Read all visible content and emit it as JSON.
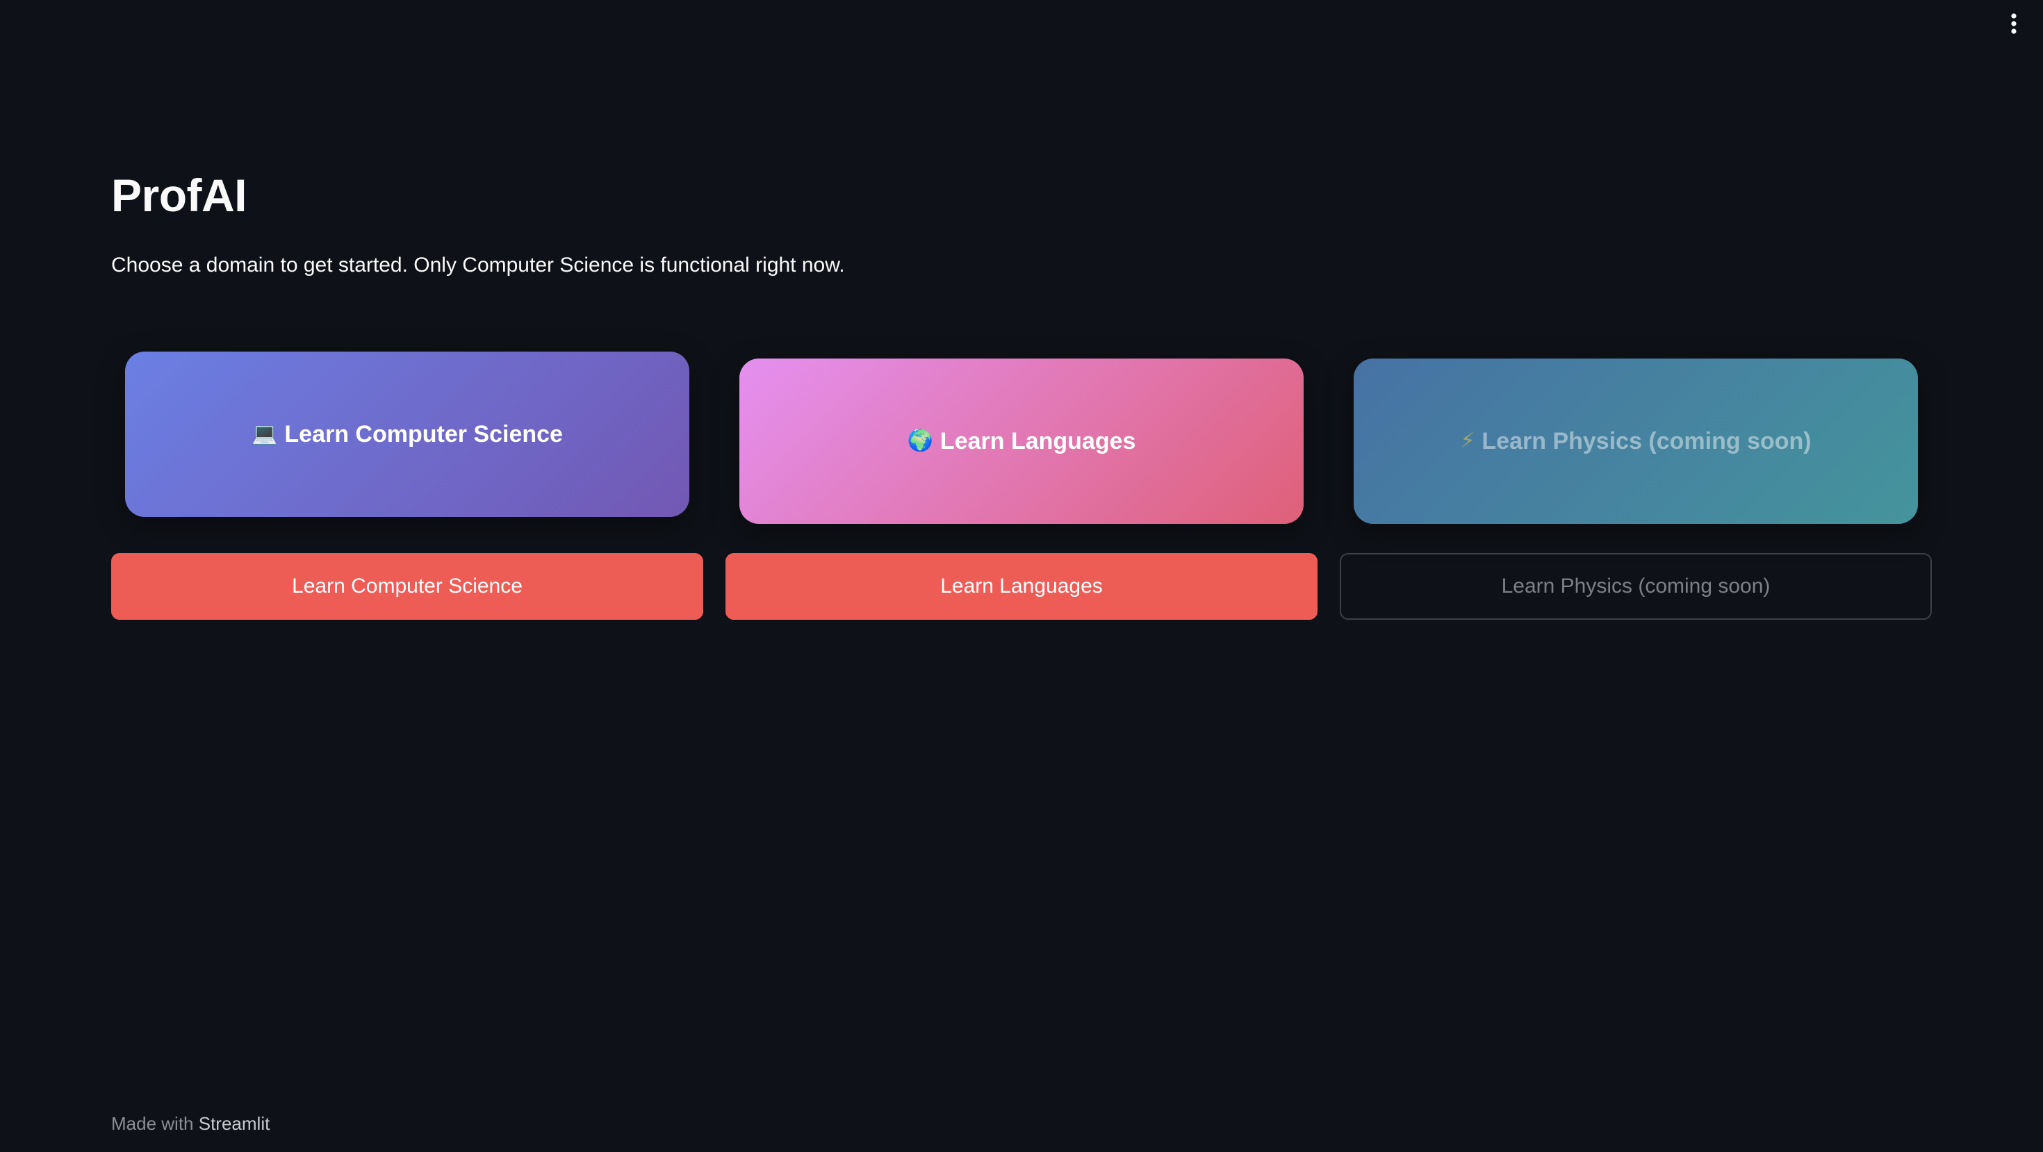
{
  "header": {
    "menu_icon": "kebab-menu-icon"
  },
  "main": {
    "title": "ProfAI",
    "subtitle": "Choose a domain to get started. Only Computer Science is functional right now."
  },
  "cards": [
    {
      "emoji": "💻",
      "icon": "laptop-icon",
      "label": "Learn Computer Science",
      "gradient": [
        "#6b7fe3",
        "#7258b4"
      ]
    },
    {
      "emoji": "🌍",
      "icon": "globe-icon",
      "label": "Learn Languages",
      "gradient": [
        "#e490f0",
        "#df6078"
      ]
    },
    {
      "emoji": "⚡",
      "icon": "lightning-icon",
      "label": "Learn Physics (coming soon)",
      "gradient": [
        "#4672a4",
        "#45949c"
      ],
      "disabled": true
    }
  ],
  "buttons": [
    {
      "label": "Learn Computer Science",
      "color": "#ee5d55"
    },
    {
      "label": "Learn Languages",
      "color": "#ee5d55"
    },
    {
      "label": "Learn Physics (coming soon)",
      "disabled": true
    }
  ],
  "footer": {
    "prefix": "Made with ",
    "link": "Streamlit"
  }
}
